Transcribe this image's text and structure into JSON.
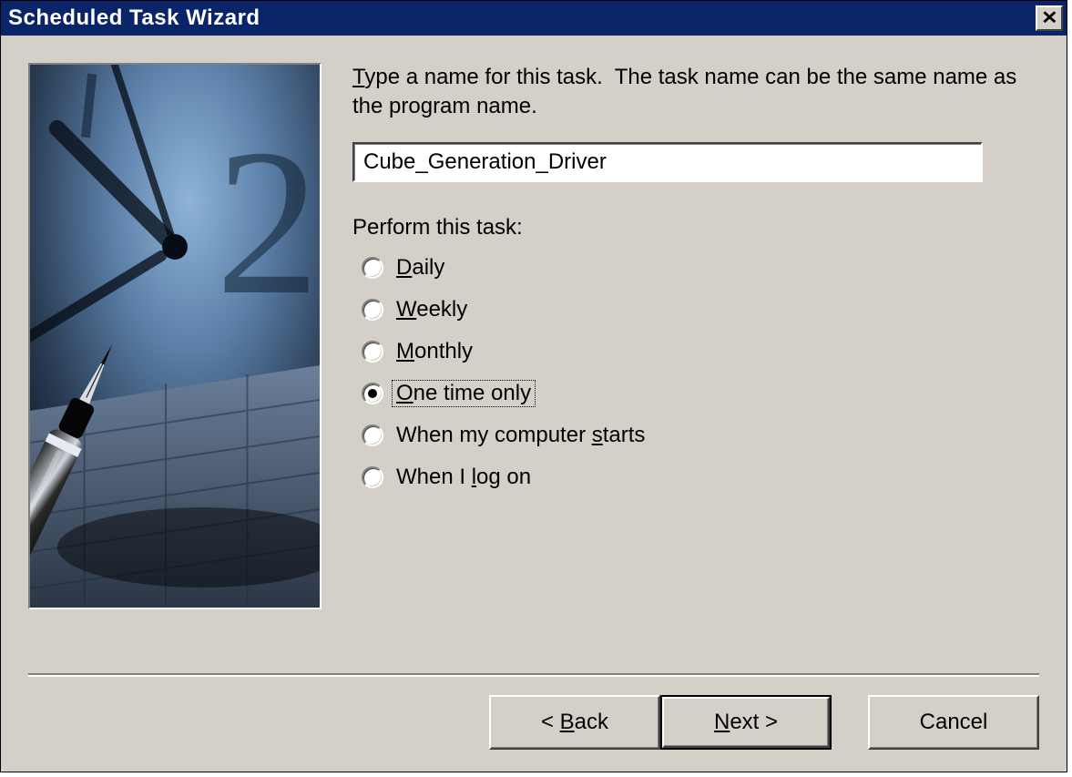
{
  "window": {
    "title": "Scheduled Task Wizard"
  },
  "main": {
    "instruction_html": "<span class=\"ul\">T</span>ype a name for this task.&nbsp; The task name can be the same name as the program name.",
    "task_name_value": "Cube_Generation_Driver",
    "perform_label": "Perform this task:",
    "options": [
      {
        "label_html": "<span class=\"ul\">D</span>aily",
        "checked": false,
        "focused": false
      },
      {
        "label_html": "<span class=\"ul\">W</span>eekly",
        "checked": false,
        "focused": false
      },
      {
        "label_html": "<span class=\"ul\">M</span>onthly",
        "checked": false,
        "focused": false
      },
      {
        "label_html": "<span class=\"ul\">O</span>ne time only",
        "checked": true,
        "focused": true
      },
      {
        "label_html": "When my computer <span class=\"ul\">s</span>tarts",
        "checked": false,
        "focused": false
      },
      {
        "label_html": "When I <span class=\"ul\">l</span>og on",
        "checked": false,
        "focused": false
      }
    ]
  },
  "buttons": {
    "back_html": "&lt; <span class=\"ul\">B</span>ack",
    "next_html": "<span class=\"ul\">N</span>ext &gt;",
    "cancel_html": "Cancel"
  }
}
